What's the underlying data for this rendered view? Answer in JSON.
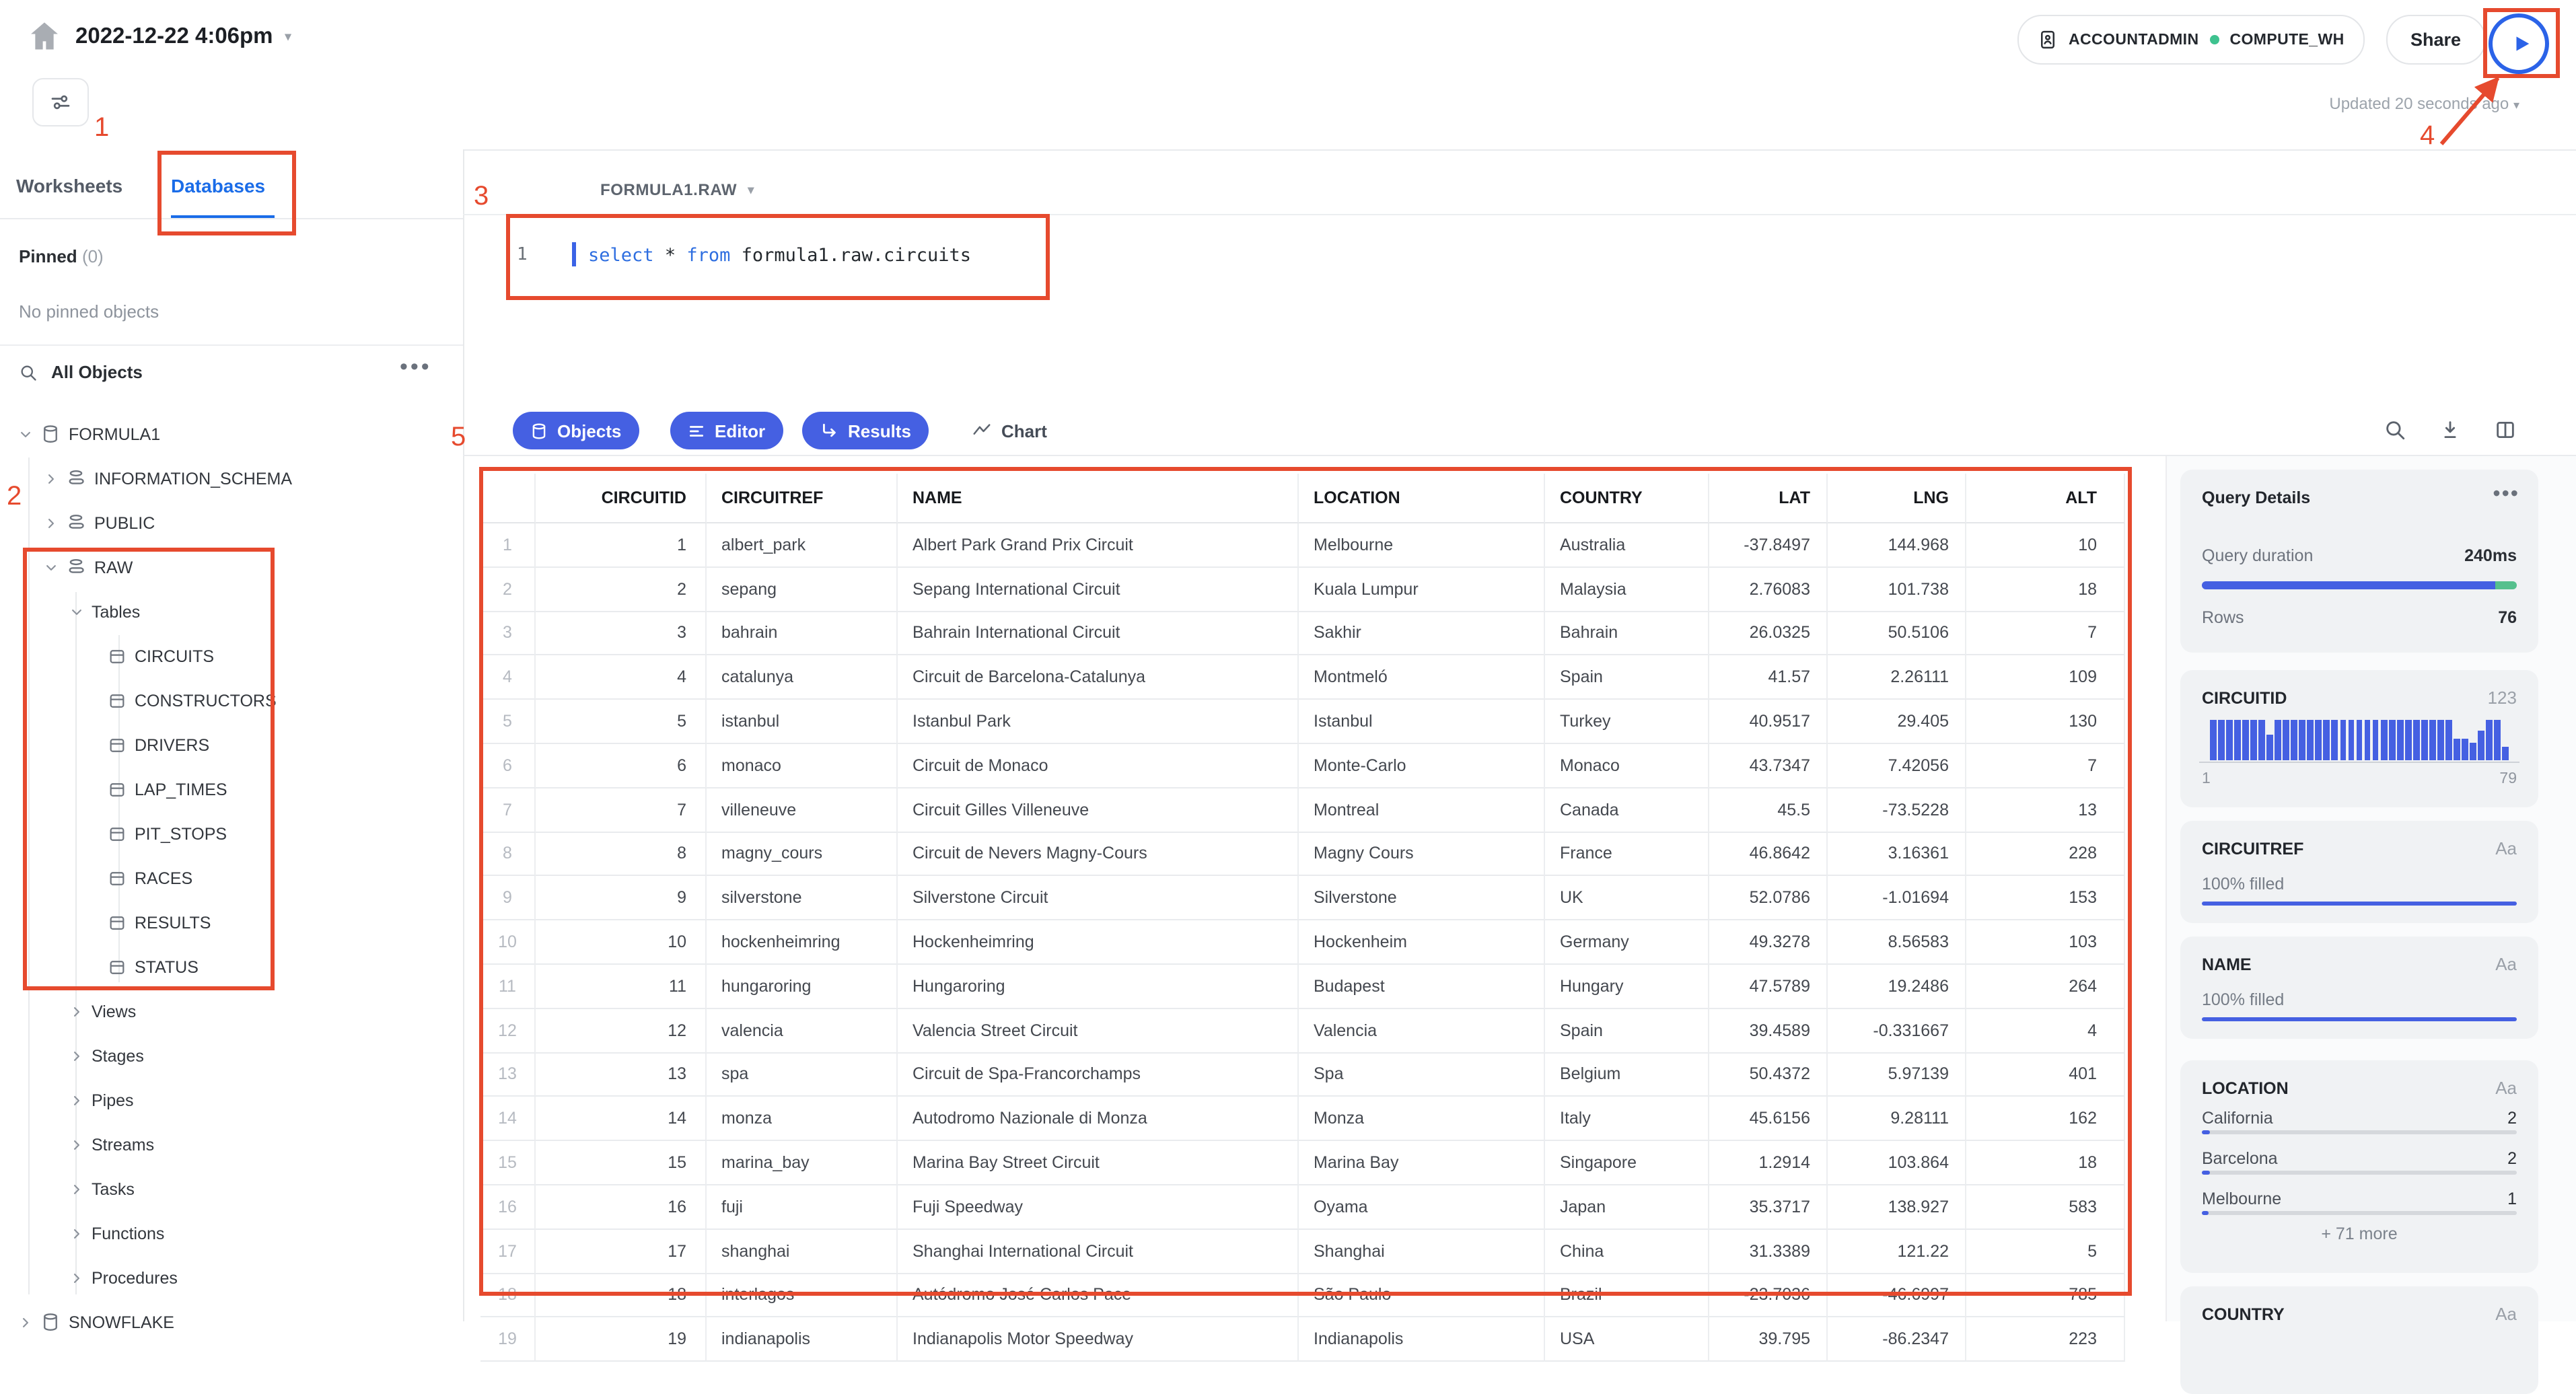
{
  "colors": {
    "accent_blue": "#4560e2",
    "link_blue": "#1a6ce8",
    "annotation_red": "#e64a2e",
    "success_green": "#56c08d",
    "sql_keyword_blue": "#2e6ee0"
  },
  "header": {
    "worksheet_title": "2022-12-22 4:06pm",
    "context_pill": {
      "role": "ACCOUNTADMIN",
      "warehouse": "COMPUTE_WH"
    },
    "share_label": "Share",
    "updated_text": "Updated 20 seconds ago"
  },
  "sidebar": {
    "tabs": {
      "worksheets": "Worksheets",
      "databases": "Databases"
    },
    "pinned": {
      "label": "Pinned",
      "count": "(0)",
      "empty_text": "No pinned objects"
    },
    "objects_search": {
      "label": "All Objects"
    },
    "tree": [
      {
        "label": "FORMULA1",
        "level": 1,
        "icon": "database",
        "chevron": "down"
      },
      {
        "label": "INFORMATION_SCHEMA",
        "level": 2,
        "icon": "schema",
        "chevron": "right"
      },
      {
        "label": "PUBLIC",
        "level": 2,
        "icon": "schema",
        "chevron": "right"
      },
      {
        "label": "RAW",
        "level": 2,
        "icon": "schema",
        "chevron": "down"
      },
      {
        "label": "Tables",
        "level": 3,
        "icon": "",
        "chevron": "down"
      },
      {
        "label": "CIRCUITS",
        "level": 4,
        "icon": "table",
        "chevron": ""
      },
      {
        "label": "CONSTRUCTORS",
        "level": 4,
        "icon": "table",
        "chevron": ""
      },
      {
        "label": "DRIVERS",
        "level": 4,
        "icon": "table",
        "chevron": ""
      },
      {
        "label": "LAP_TIMES",
        "level": 4,
        "icon": "table",
        "chevron": ""
      },
      {
        "label": "PIT_STOPS",
        "level": 4,
        "icon": "table",
        "chevron": ""
      },
      {
        "label": "RACES",
        "level": 4,
        "icon": "table",
        "chevron": ""
      },
      {
        "label": "RESULTS",
        "level": 4,
        "icon": "table",
        "chevron": ""
      },
      {
        "label": "STATUS",
        "level": 4,
        "icon": "table",
        "chevron": ""
      },
      {
        "label": "Views",
        "level": 3,
        "icon": "",
        "chevron": "right"
      },
      {
        "label": "Stages",
        "level": 3,
        "icon": "",
        "chevron": "right"
      },
      {
        "label": "Pipes",
        "level": 3,
        "icon": "",
        "chevron": "right"
      },
      {
        "label": "Streams",
        "level": 3,
        "icon": "",
        "chevron": "right"
      },
      {
        "label": "Tasks",
        "level": 3,
        "icon": "",
        "chevron": "right"
      },
      {
        "label": "Functions",
        "level": 3,
        "icon": "",
        "chevron": "right"
      },
      {
        "label": "Procedures",
        "level": 3,
        "icon": "",
        "chevron": "right"
      },
      {
        "label": "SNOWFLAKE",
        "level": 1,
        "icon": "database",
        "chevron": "right"
      }
    ]
  },
  "editor": {
    "context_tab": "FORMULA1.RAW",
    "line_number": "1",
    "sql": [
      {
        "text": "select",
        "type": "keyword"
      },
      {
        "text": " * ",
        "type": "plain"
      },
      {
        "text": "from",
        "type": "keyword"
      },
      {
        "text": " formula1.raw.circuits",
        "type": "plain"
      }
    ]
  },
  "result_tabs": {
    "objects": "Objects",
    "editor": "Editor",
    "results": "Results",
    "chart": "Chart"
  },
  "results_table": {
    "columns": [
      "CIRCUITID",
      "CIRCUITREF",
      "NAME",
      "LOCATION",
      "COUNTRY",
      "LAT",
      "LNG",
      "ALT"
    ],
    "rows": [
      [
        "1",
        "albert_park",
        "Albert Park Grand Prix Circuit",
        "Melbourne",
        "Australia",
        "-37.8497",
        "144.968",
        "10"
      ],
      [
        "2",
        "sepang",
        "Sepang International Circuit",
        "Kuala Lumpur",
        "Malaysia",
        "2.76083",
        "101.738",
        "18"
      ],
      [
        "3",
        "bahrain",
        "Bahrain International Circuit",
        "Sakhir",
        "Bahrain",
        "26.0325",
        "50.5106",
        "7"
      ],
      [
        "4",
        "catalunya",
        "Circuit de Barcelona-Catalunya",
        "Montmeló",
        "Spain",
        "41.57",
        "2.26111",
        "109"
      ],
      [
        "5",
        "istanbul",
        "Istanbul Park",
        "Istanbul",
        "Turkey",
        "40.9517",
        "29.405",
        "130"
      ],
      [
        "6",
        "monaco",
        "Circuit de Monaco",
        "Monte-Carlo",
        "Monaco",
        "43.7347",
        "7.42056",
        "7"
      ],
      [
        "7",
        "villeneuve",
        "Circuit Gilles Villeneuve",
        "Montreal",
        "Canada",
        "45.5",
        "-73.5228",
        "13"
      ],
      [
        "8",
        "magny_cours",
        "Circuit de Nevers Magny-Cours",
        "Magny Cours",
        "France",
        "46.8642",
        "3.16361",
        "228"
      ],
      [
        "9",
        "silverstone",
        "Silverstone Circuit",
        "Silverstone",
        "UK",
        "52.0786",
        "-1.01694",
        "153"
      ],
      [
        "10",
        "hockenheimring",
        "Hockenheimring",
        "Hockenheim",
        "Germany",
        "49.3278",
        "8.56583",
        "103"
      ],
      [
        "11",
        "hungaroring",
        "Hungaroring",
        "Budapest",
        "Hungary",
        "47.5789",
        "19.2486",
        "264"
      ],
      [
        "12",
        "valencia",
        "Valencia Street Circuit",
        "Valencia",
        "Spain",
        "39.4589",
        "-0.331667",
        "4"
      ],
      [
        "13",
        "spa",
        "Circuit de Spa-Francorchamps",
        "Spa",
        "Belgium",
        "50.4372",
        "5.97139",
        "401"
      ],
      [
        "14",
        "monza",
        "Autodromo Nazionale di Monza",
        "Monza",
        "Italy",
        "45.6156",
        "9.28111",
        "162"
      ],
      [
        "15",
        "marina_bay",
        "Marina Bay Street Circuit",
        "Marina Bay",
        "Singapore",
        "1.2914",
        "103.864",
        "18"
      ],
      [
        "16",
        "fuji",
        "Fuji Speedway",
        "Oyama",
        "Japan",
        "35.3717",
        "138.927",
        "583"
      ],
      [
        "17",
        "shanghai",
        "Shanghai International Circuit",
        "Shanghai",
        "China",
        "31.3389",
        "121.22",
        "5"
      ],
      [
        "18",
        "interlagos",
        "Autódromo José Carlos Pace",
        "São Paulo",
        "Brazil",
        "-23.7036",
        "-46.6997",
        "785"
      ],
      [
        "19",
        "indianapolis",
        "Indianapolis Motor Speedway",
        "Indianapolis",
        "USA",
        "39.795",
        "-86.2347",
        "223"
      ]
    ]
  },
  "query_details_panel": {
    "title": "Query Details",
    "query_duration_label": "Query duration",
    "query_duration_value": "240ms",
    "duration_blue_fraction": 0.93,
    "rows_label": "Rows",
    "rows_value": "76",
    "circuitid": {
      "name": "CIRCUITID",
      "type_label": "123",
      "histogram": {
        "type": "bar",
        "min_label": "1",
        "max_label": "79",
        "relative_heights": [
          1,
          1,
          1,
          1,
          1,
          1,
          1,
          0.62,
          1,
          1,
          1,
          1,
          1,
          1,
          1,
          1,
          1,
          1,
          1,
          1,
          1,
          1,
          1,
          1,
          1,
          1,
          1,
          1,
          1,
          1,
          0.55,
          0.55,
          0.45,
          0.72,
          1,
          1,
          0.35
        ]
      }
    },
    "circuitref": {
      "name": "CIRCUITREF",
      "type_label": "Aa",
      "filled_text": "100% filled"
    },
    "name_col": {
      "name": "NAME",
      "type_label": "Aa",
      "filled_text": "100% filled"
    },
    "location": {
      "name": "LOCATION",
      "type_label": "Aa",
      "entries": [
        {
          "value": "California",
          "count": "2"
        },
        {
          "value": "Barcelona",
          "count": "2"
        },
        {
          "value": "Melbourne",
          "count": "1"
        }
      ],
      "more_text": "+ 71 more",
      "total_rows": 76
    },
    "country": {
      "name": "COUNTRY",
      "type_label": "Aa"
    }
  },
  "annotations": {
    "labels": [
      "1",
      "2",
      "3",
      "4",
      "5"
    ]
  }
}
